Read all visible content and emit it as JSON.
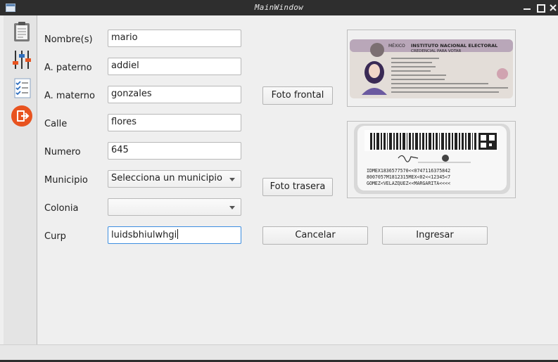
{
  "window": {
    "title": "MainWindow"
  },
  "sidebar": {
    "items": [
      {
        "icon": "clipboard-icon"
      },
      {
        "icon": "sliders-icon"
      },
      {
        "icon": "checklist-icon"
      },
      {
        "icon": "exit-icon"
      }
    ]
  },
  "form": {
    "nombre": {
      "label": "Nombre(s)",
      "value": "mario"
    },
    "paterno": {
      "label": "A. paterno",
      "value": "addiel"
    },
    "materno": {
      "label": "A. materno",
      "value": "gonzales"
    },
    "calle": {
      "label": "Calle",
      "value": "flores"
    },
    "numero": {
      "label": "Numero",
      "value": "645"
    },
    "municipio": {
      "label": "Municipio",
      "selected": "Selecciona un municipio"
    },
    "colonia": {
      "label": "Colonia",
      "selected": ""
    },
    "curp": {
      "label": "Curp",
      "value": "luidsbhiulwhgi"
    }
  },
  "buttons": {
    "foto_frontal": "Foto frontal",
    "foto_trasera": "Foto trasera",
    "cancelar": "Cancelar",
    "ingresar": "Ingresar"
  },
  "id_front": {
    "country": "MÉXICO",
    "institute": "INSTITUTO NACIONAL ELECTORAL",
    "card_type": "CREDENCIAL PARA VOTAR"
  },
  "id_back": {
    "mrz_line1": "IDMEX1836577570<<0747116375842",
    "mrz_line2": "8007057M1812315MEX<02<<12345<7",
    "mrz_line3": "GOMEZ<VELAZQUEZ<<MARGARITA<<<<"
  },
  "colors": {
    "accent": "#3d8ee0",
    "exit": "#e8531f"
  }
}
